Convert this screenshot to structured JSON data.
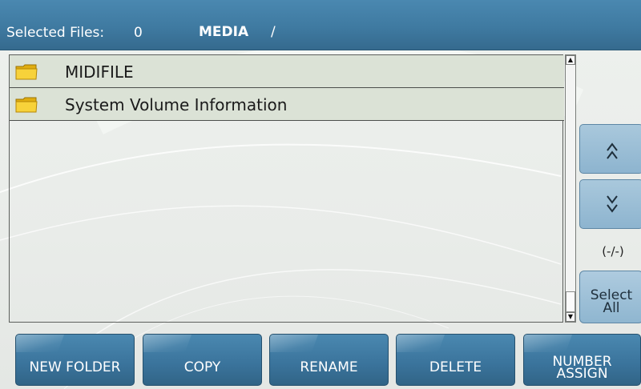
{
  "header": {
    "selected_label": "Selected Files:",
    "selected_count": "0",
    "path": "MEDIA",
    "path_separator": "/"
  },
  "files": [
    {
      "name": "MIDIFILE",
      "icon": "folder-icon"
    },
    {
      "name": "System Volume Information",
      "icon": "folder-icon"
    }
  ],
  "side_panel": {
    "page_up_icon": "double-chevron-up-icon",
    "page_down_icon": "double-chevron-down-icon",
    "pager_text": "(-/-)",
    "select_all_line1": "Select",
    "select_all_line2": "All"
  },
  "toolbar": {
    "new_folder": "NEW FOLDER",
    "copy": "COPY",
    "rename": "RENAME",
    "delete": "DELETE",
    "number_assign_line1": "NUMBER",
    "number_assign_line2": "ASSIGN"
  },
  "colors": {
    "header_blue": "#3f7aa1",
    "button_blue": "#3a739b",
    "side_button_blue": "#8db4cf",
    "row_green": "#dbe2d6",
    "folder_yellow": "#f5cc1f"
  }
}
